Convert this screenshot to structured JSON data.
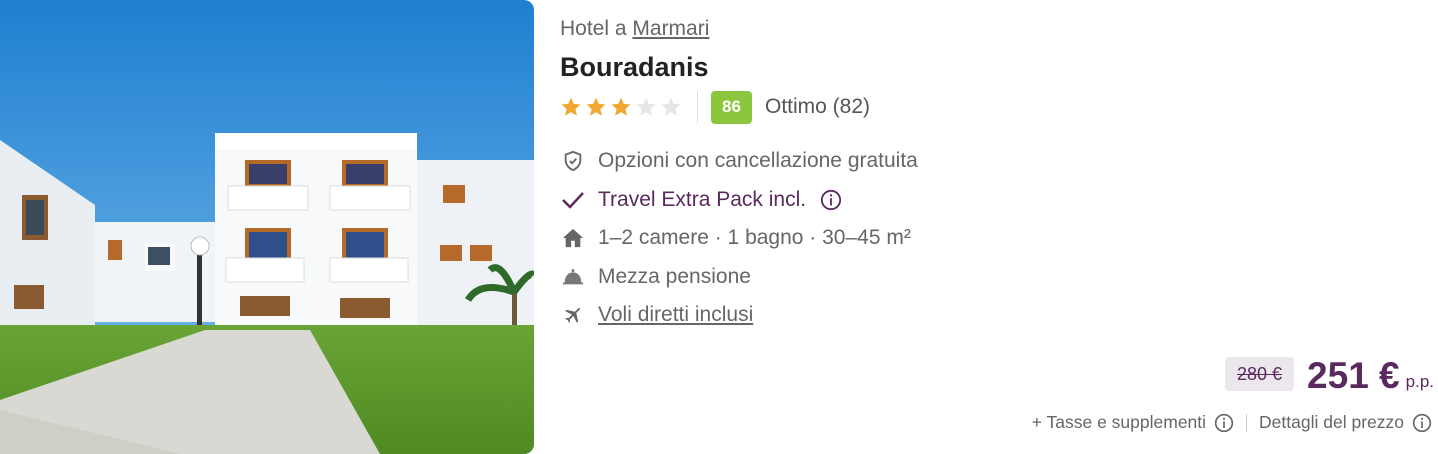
{
  "listing": {
    "location_prefix": "Hotel a",
    "location_link": "Marmari",
    "hotel_name": "Bouradanis",
    "stars": {
      "filled": 3,
      "total": 5
    },
    "score": "86",
    "score_label": "Ottimo (82)"
  },
  "features": {
    "cancellation": "Opzioni con cancellazione gratuita",
    "extra_pack": "Travel Extra Pack incl.",
    "rooms": "1–2 camere · 1 bagno · 30–45 m²",
    "board": "Mezza pensione",
    "flights": "Voli diretti inclusi"
  },
  "price": {
    "old": "280 €",
    "current": "251 €",
    "unit": "p.p.",
    "taxes_link": "+ Tasse e supplementi",
    "details_link": "Dettagli del prezzo"
  },
  "colors": {
    "accent": "#5a2a5e",
    "score_badge": "#8cc63f",
    "star": "#f0a830"
  },
  "icons": [
    "shield-check-icon",
    "checkmark-icon",
    "info-icon",
    "home-icon",
    "room-service-bell-icon",
    "plane-icon"
  ]
}
